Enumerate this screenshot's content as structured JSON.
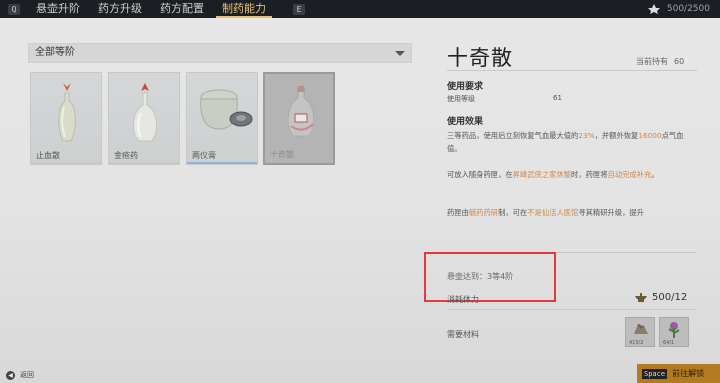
{
  "topbar": {
    "left_key": "Q",
    "tabs": [
      {
        "label": "悬壶升阶",
        "active": false
      },
      {
        "label": "药方升级",
        "active": false
      },
      {
        "label": "药方配置",
        "active": false
      },
      {
        "label": "制药能力",
        "active": true
      }
    ],
    "right_key": "E",
    "resource": "500/2500",
    "accent_color": "#e5c07b"
  },
  "filter": {
    "value": "全部等阶"
  },
  "items": [
    {
      "name": "止血散",
      "icon": "vase-red-flower-icon",
      "bar_color": "#c9c9c9"
    },
    {
      "name": "金疮药",
      "icon": "bottle-red-flower-icon",
      "bar_color": "#c9c9c9"
    },
    {
      "name": "两仪膏",
      "icon": "jar-lid-icon",
      "bar_color": "#8fb3d9"
    },
    {
      "name": "十奇散",
      "icon": "sealed-bottle-icon",
      "bar_color": "#9a9a9a",
      "selected": true
    }
  ],
  "detail": {
    "title": "十奇散",
    "owned_label": "当前持有",
    "owned_value": "60",
    "req_heading": "使用要求",
    "req_label": "使用等级",
    "req_value": "61",
    "effect_heading": "使用效果",
    "effect_p1_a": "三等药品，使用后立刻恢复气血最大值的",
    "effect_p1_b": "23%",
    "effect_p1_c": "，并额外恢复",
    "effect_p1_d": "16000",
    "effect_p1_e": "点气血值。",
    "effect_p2_a": "可放入随身药匣，在",
    "effect_p2_b": "昇峰武侠之家休整",
    "effect_p2_c": "时，药匣将",
    "effect_p2_d": "自动完成补充",
    "effect_p2_e": "。",
    "effect_p3_a": "药匣由",
    "effect_p3_b": "毓药药研",
    "effect_p3_c": "制，可在",
    "effect_p3_d": "不是仙活人医馆",
    "effect_p3_e": "寻其精研升级，提升",
    "condition": "悬壶达到：3等4阶",
    "stamina_label": "消耗体力",
    "stamina_value": "500/12",
    "materials_label": "需要材料",
    "materials": [
      {
        "icon": "ore-material-icon",
        "count": "415/2"
      },
      {
        "icon": "herb-material-icon",
        "count": "64/1"
      }
    ]
  },
  "footer": {
    "back_label": "返回",
    "action_key": "Space",
    "action_label": "前往解锁"
  }
}
